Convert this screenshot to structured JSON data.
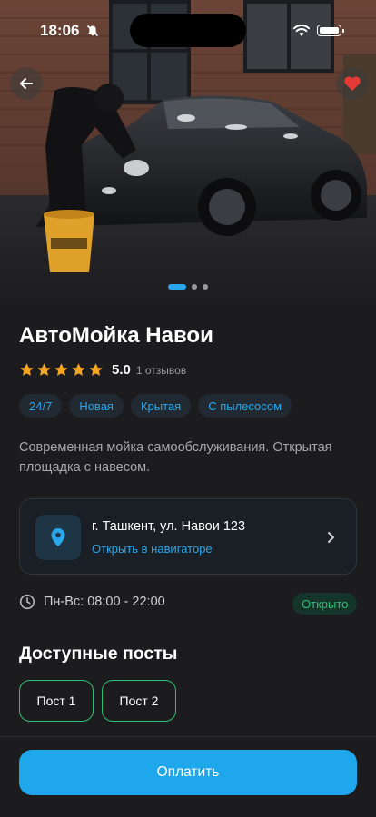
{
  "status_bar": {
    "time": "18:06"
  },
  "hero": {
    "slide_count": 3,
    "active_slide": 0,
    "favorite": true
  },
  "wash": {
    "title": "АвтоМойка Навои",
    "rating": 5,
    "rating_value": "5.0",
    "reviews": "1 отзывов",
    "tags": [
      "24/7",
      "Новая",
      "Крытая",
      "С пылесосом"
    ],
    "description": "Современная мойка самообслуживания. Открытая площадка с навесом."
  },
  "address": {
    "text": "г. Ташкент, ул. Навои 123",
    "link": "Открыть в навигаторе"
  },
  "hours": {
    "text": "Пн-Вс: 08:00 - 22:00",
    "status": "Открыто"
  },
  "posts": {
    "title": "Доступные посты",
    "items": [
      "Пост 1",
      "Пост 2"
    ]
  },
  "footer": {
    "pay_label": "Оплатить"
  },
  "colors": {
    "accent": "#1ea7ea",
    "open": "#2fbf71",
    "star": "#f5a623",
    "favorite": "#e53935"
  },
  "icons": [
    "silent-bell-icon",
    "wifi-icon",
    "battery-icon",
    "back-arrow-icon",
    "heart-icon",
    "star-icon",
    "location-pin-icon",
    "chevron-right-icon",
    "clock-icon"
  ]
}
